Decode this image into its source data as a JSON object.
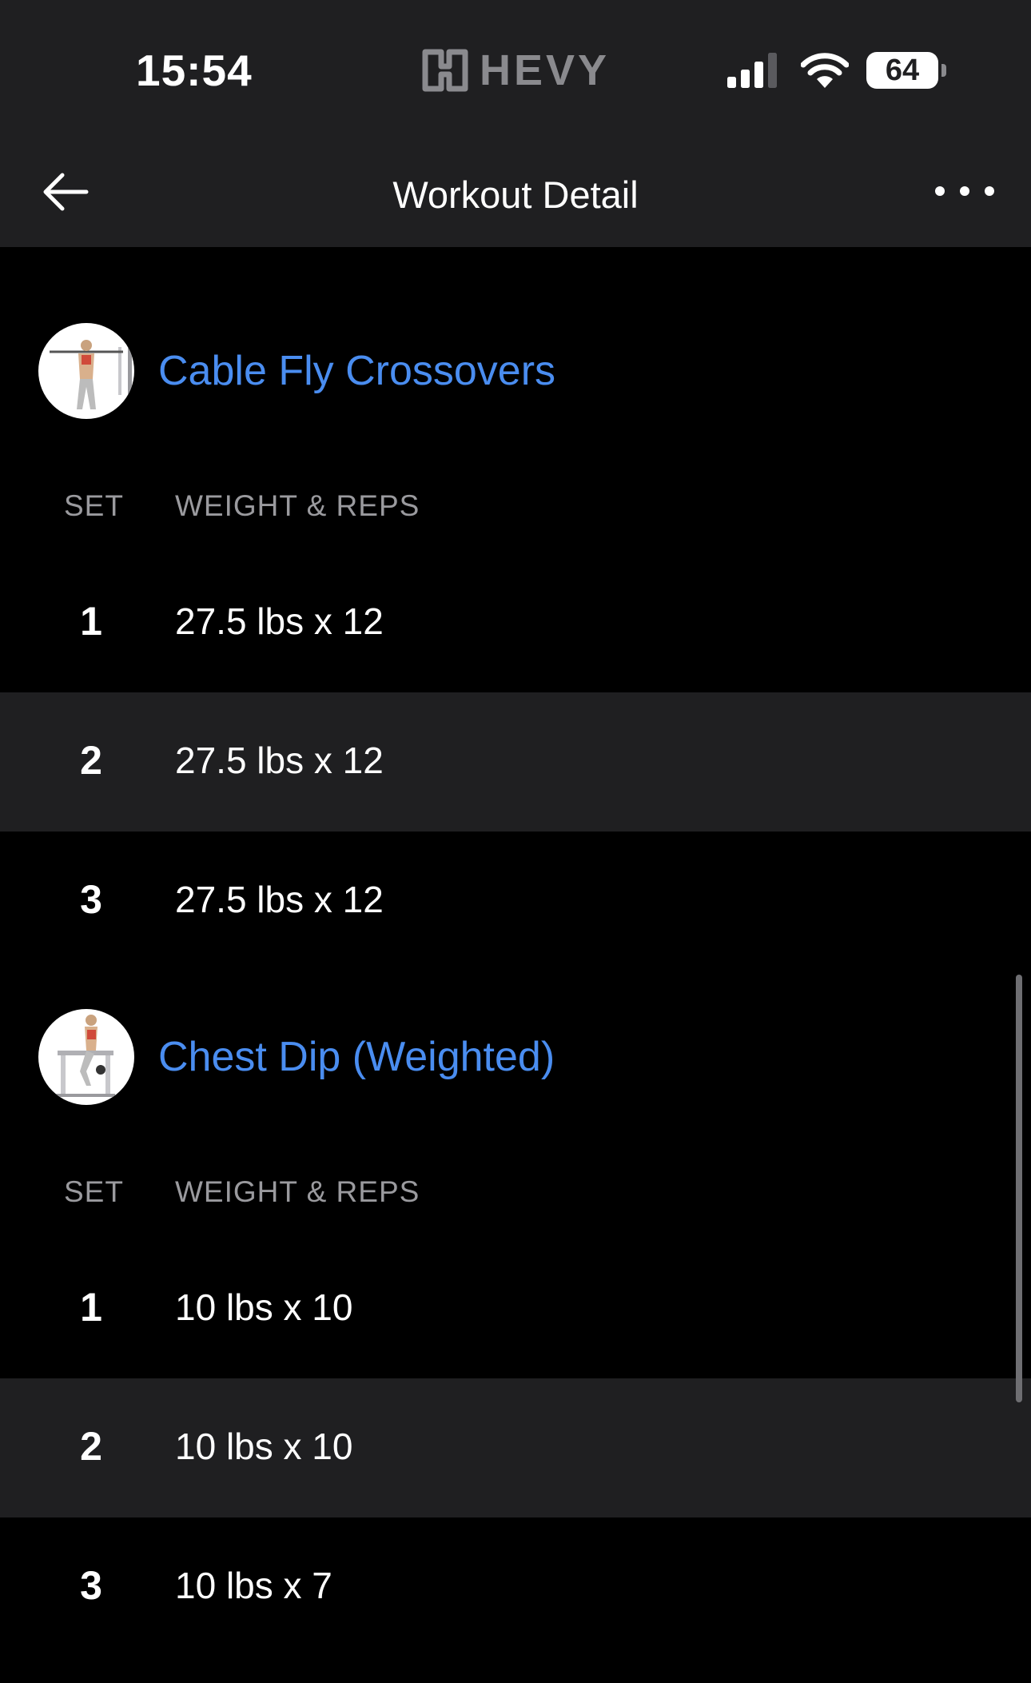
{
  "status_bar": {
    "time": "15:54",
    "logo_text": "HEVY",
    "battery_level": "64",
    "icons": [
      "signal-icon",
      "wifi-icon",
      "battery-icon"
    ]
  },
  "nav": {
    "title": "Workout Detail",
    "back_icon": "arrow-left-icon",
    "more_icon": "more-horizontal-icon"
  },
  "colors": {
    "accent": "#4a8df0",
    "bar_background": "#1f1f21",
    "alt_row_background": "#1f1f21",
    "page_background": "#000000",
    "muted_text": "#9a9a9e"
  },
  "exercises": [
    {
      "name": "Cable Fly Crossovers",
      "thumbnail_icon": "exercise-illustration-icon",
      "columns": {
        "set": "SET",
        "weight_reps": "WEIGHT & REPS"
      },
      "sets": [
        {
          "set": "1",
          "value": "27.5 lbs x 12"
        },
        {
          "set": "2",
          "value": "27.5 lbs x 12"
        },
        {
          "set": "3",
          "value": "27.5 lbs x 12"
        }
      ]
    },
    {
      "name": "Chest Dip (Weighted)",
      "thumbnail_icon": "exercise-illustration-icon",
      "columns": {
        "set": "SET",
        "weight_reps": "WEIGHT & REPS"
      },
      "sets": [
        {
          "set": "1",
          "value": "10 lbs x 10"
        },
        {
          "set": "2",
          "value": "10 lbs x 10"
        },
        {
          "set": "3",
          "value": "10 lbs x 7"
        }
      ]
    }
  ]
}
